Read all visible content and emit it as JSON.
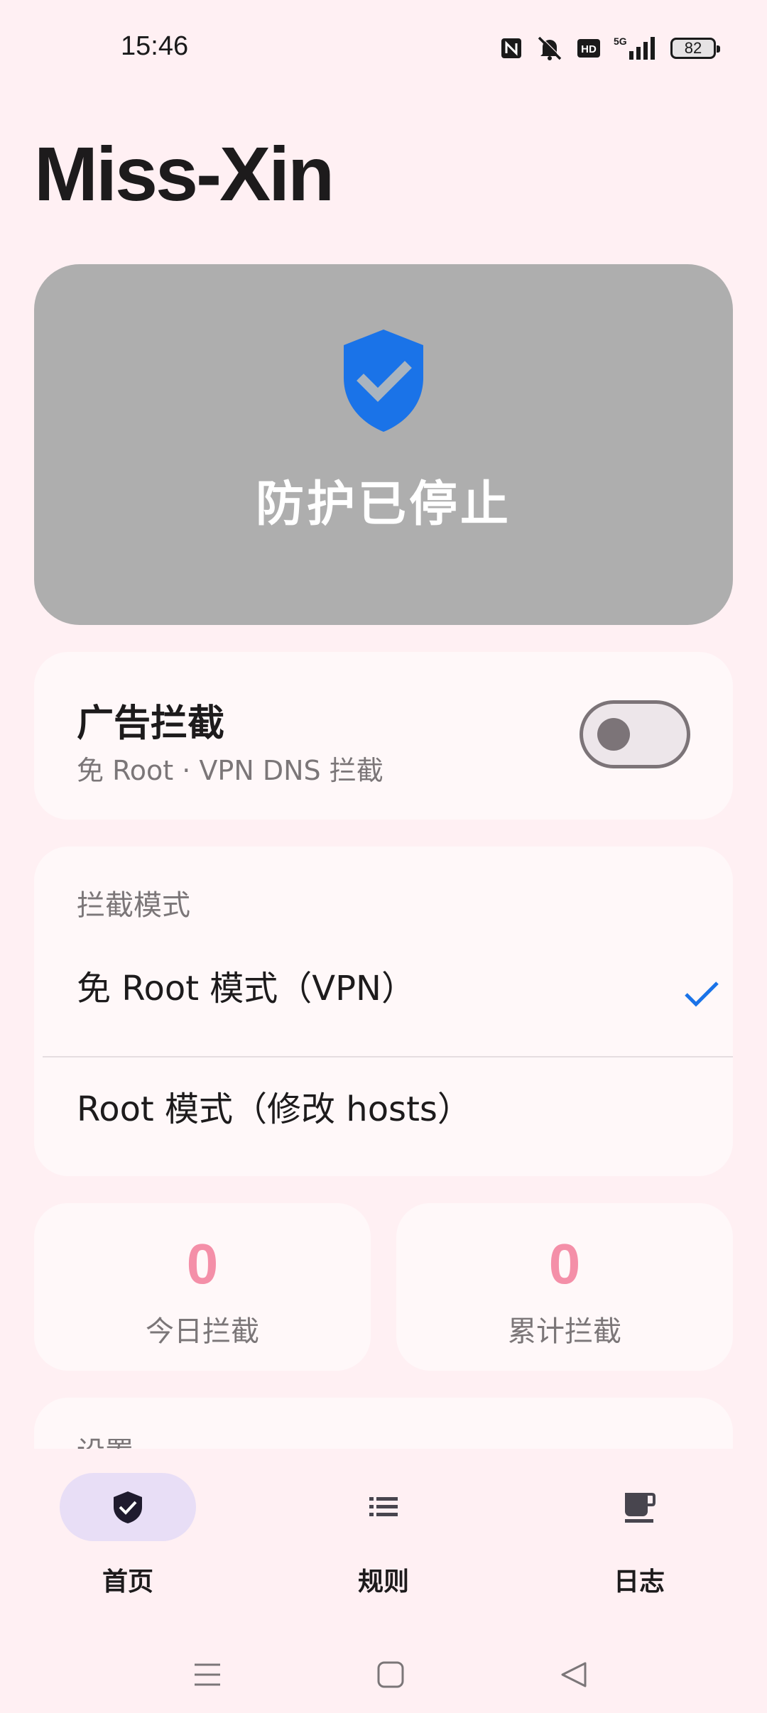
{
  "status_bar": {
    "time": "15:46",
    "icons": [
      "nfc-icon",
      "mute-icon",
      "hd-icon",
      "5g-signal-icon",
      "battery-icon"
    ],
    "network": "5G",
    "hd": "HD",
    "battery": "82"
  },
  "app": {
    "title": "Miss-Xin"
  },
  "protection": {
    "status": "防护已停止",
    "icon": "shield-check-icon",
    "card_color": "#aeaeae",
    "shield_color": "#1a73e8"
  },
  "adblock": {
    "title": "广告拦截",
    "subtitle": "免 Root · VPN DNS 拦截",
    "enabled": false
  },
  "block_mode": {
    "header": "拦截模式",
    "options": [
      {
        "label": "免 Root 模式（VPN）",
        "selected": true
      },
      {
        "label": "Root 模式（修改 hosts）",
        "selected": false
      }
    ]
  },
  "stats": {
    "today": {
      "value": "0",
      "label": "今日拦截"
    },
    "total": {
      "value": "0",
      "label": "累计拦截"
    },
    "accent": "#f48fa8"
  },
  "settings": {
    "header": "设置"
  },
  "bottom_nav": {
    "items": [
      {
        "label": "首页",
        "icon": "shield-check-icon",
        "active": true
      },
      {
        "label": "规则",
        "icon": "list-icon",
        "active": false
      },
      {
        "label": "日志",
        "icon": "coffee-cup-icon",
        "active": false
      }
    ]
  },
  "system_nav": {
    "buttons": [
      "menu-icon",
      "home-icon",
      "back-icon"
    ]
  }
}
